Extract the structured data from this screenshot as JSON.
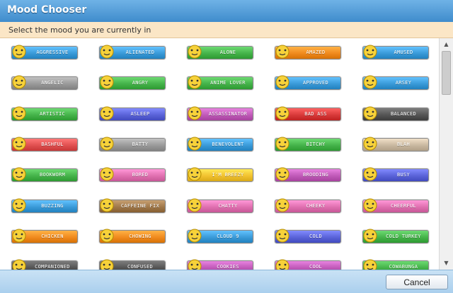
{
  "window": {
    "title": "Mood Chooser"
  },
  "header": {
    "text": "Select the mood you are currently in"
  },
  "footer": {
    "cancel_label": "Cancel"
  },
  "moods": [
    {
      "label": "AGGRESSIVE",
      "color": "#3a9ad8",
      "icon": "angry-face-icon"
    },
    {
      "label": "ALIENATED",
      "color": "#3a9ad8",
      "icon": "alien-icon"
    },
    {
      "label": "ALONE",
      "color": "#45b34a",
      "icon": "grey-alien-icon"
    },
    {
      "label": "AMAZED",
      "color": "#f08a1e",
      "icon": "amazed-face-icon"
    },
    {
      "label": "AMUSED",
      "color": "#3a9ad8",
      "icon": "amused-face-icon"
    },
    {
      "label": "ANGELIC",
      "color": "#9a9a9a",
      "icon": "angel-icon"
    },
    {
      "label": "ANGRY",
      "color": "#45b34a",
      "icon": "angry-red-face-icon"
    },
    {
      "label": "ANIME LOVER",
      "color": "#45b34a",
      "icon": "anime-face-icon"
    },
    {
      "label": "APPROVED",
      "color": "#3a9ad8",
      "icon": "thumbs-up-icon"
    },
    {
      "label": "ARSEY",
      "color": "#3a9ad8",
      "icon": "arsey-icon"
    },
    {
      "label": "ARTISTIC",
      "color": "#45b34a",
      "icon": "palette-icon"
    },
    {
      "label": "ASLEEP",
      "color": "#5a63d8",
      "icon": "sleepy-face-icon"
    },
    {
      "label": "ASSASSINATOR",
      "color": "#c05ab8",
      "icon": "ninja-icon"
    },
    {
      "label": "BAD ASS",
      "color": "#d83a3a",
      "icon": "gun-face-icon"
    },
    {
      "label": "BALANCED",
      "color": "#555555",
      "icon": "yin-yang-icon"
    },
    {
      "label": "BASHFUL",
      "color": "#e05050",
      "icon": "bashful-face-icon"
    },
    {
      "label": "BATTY",
      "color": "#9a9a9a",
      "icon": "bat-icon"
    },
    {
      "label": "BENEVOLENT",
      "color": "#3a9ad8",
      "icon": "sword-icon"
    },
    {
      "label": "BITCHY",
      "color": "#45b34a",
      "icon": "two-angry-faces-icon"
    },
    {
      "label": "BLAH",
      "color": "#c9b8a0",
      "icon": "blah-face-icon"
    },
    {
      "label": "BOOKWORM",
      "color": "#45b34a",
      "icon": "book-icon"
    },
    {
      "label": "BORED",
      "color": "#e070b0",
      "icon": "bored-face-icon"
    },
    {
      "label": "I'M BREEZY",
      "color": "#f2c230",
      "icon": "breezy-face-icon"
    },
    {
      "label": "BROODING",
      "color": "#c05ab8",
      "icon": "brooding-face-icon"
    },
    {
      "label": "BUSY",
      "color": "#5a63d8",
      "icon": "bee-icon"
    },
    {
      "label": "BUZZING",
      "color": "#3a9ad8",
      "icon": "pill-icon"
    },
    {
      "label": "CAFFEINE FIX",
      "color": "#a0784a",
      "icon": "coffee-cup-icon"
    },
    {
      "label": "CHATTY",
      "color": "#e070b0",
      "icon": "chatty-faces-icon"
    },
    {
      "label": "CHEEKY",
      "color": "#e070b0",
      "icon": "tongue-face-icon"
    },
    {
      "label": "CHEERFUL",
      "color": "#e070b0",
      "icon": "cheerful-face-icon"
    },
    {
      "label": "CHICKEN",
      "color": "#f08a1e",
      "icon": "chicken-icon"
    },
    {
      "label": "CHOWING",
      "color": "#f08a1e",
      "icon": "bowl-icon"
    },
    {
      "label": "CLOUD 9",
      "color": "#3a9ad8",
      "icon": "cloud-face-icon"
    },
    {
      "label": "COLD",
      "color": "#5a63d8",
      "icon": "cold-face-icon"
    },
    {
      "label": "COLD TURKEY",
      "color": "#45b34a",
      "icon": "cold-turkey-face-icon"
    },
    {
      "label": "COMPANIONED",
      "color": "#555555",
      "icon": "panda-icon"
    },
    {
      "label": "CONFUSED",
      "color": "#555555",
      "icon": "confused-face-icon"
    },
    {
      "label": "COOKIES",
      "color": "#c05ab8",
      "icon": "cookie-icon"
    },
    {
      "label": "COOL",
      "color": "#c05ab8",
      "icon": "sunglasses-face-icon"
    },
    {
      "label": "COWABUNGA",
      "color": "#45b34a",
      "icon": "turtle-icon"
    }
  ]
}
